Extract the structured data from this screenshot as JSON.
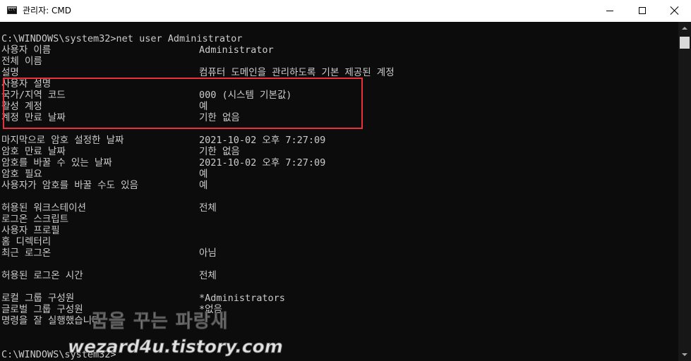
{
  "window": {
    "title": "관리자: CMD",
    "icon": "cmd-console-icon",
    "controls": [
      "minimize-icon",
      "maximize-icon",
      "close-icon"
    ]
  },
  "console": {
    "command_line": "C:\\WINDOWS\\system32>net user Administrator",
    "rows": [
      {
        "label": "사용자 이름",
        "value": "Administrator"
      },
      {
        "label": "전체 이름",
        "value": ""
      },
      {
        "label": "설명",
        "value": "컴퓨터 도메인을 관리하도록 기본 제공된 계정"
      },
      {
        "label": "사용자 설명",
        "value": ""
      },
      {
        "label": "국가/지역 코드",
        "value": "000 (시스템 기본값)"
      },
      {
        "label": "활성 계정",
        "value": "예"
      },
      {
        "label": "계정 만료 날짜",
        "value": "기한 없음"
      },
      {
        "label": "",
        "value": ""
      },
      {
        "label": "마지막으로 암호 설정한 날짜",
        "value": "2021-10-02 오후 7:27:09"
      },
      {
        "label": "암호 만료 날짜",
        "value": "기한 없음"
      },
      {
        "label": "암호를 바꿀 수 있는 날짜",
        "value": "2021-10-02 오후 7:27:09"
      },
      {
        "label": "암호 필요",
        "value": "예"
      },
      {
        "label": "사용자가 암호를 바꿀 수도 있음",
        "value": "예"
      },
      {
        "label": "",
        "value": ""
      },
      {
        "label": "허용된 워크스테이션",
        "value": "전체"
      },
      {
        "label": "로그온 스크립트",
        "value": ""
      },
      {
        "label": "사용자 프로필",
        "value": ""
      },
      {
        "label": "홈 디렉터리",
        "value": ""
      },
      {
        "label": "최근 로그온",
        "value": "아님"
      },
      {
        "label": "",
        "value": ""
      },
      {
        "label": "허용된 로그온 시간",
        "value": "전체"
      },
      {
        "label": "",
        "value": ""
      },
      {
        "label": "로컬 그룹 구성원",
        "value": "*Administrators"
      },
      {
        "label": "글로벌 그룹 구성원",
        "value": "*없음"
      },
      {
        "label": "명령을 잘 실행했습니다.",
        "value": ""
      },
      {
        "label": "",
        "value": ""
      },
      {
        "label": "",
        "value": ""
      }
    ],
    "prompt": "C:\\WINDOWS\\system32>"
  },
  "watermark": {
    "line1": "꿈을 꾸는 파랑새",
    "line2": "wezard4u.tistory.com"
  },
  "colors": {
    "console_background": "#0c0c0c",
    "console_text": "#cccccc",
    "highlight_box": "#e8313c",
    "titlebar_background": "#ffffff"
  }
}
